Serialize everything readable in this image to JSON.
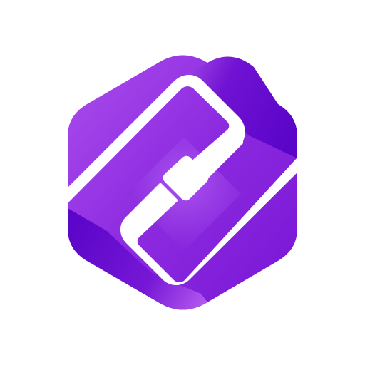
{
  "app_icon": {
    "name": "purple-hexagon-logo-icon",
    "colors": {
      "light_purple": "#C66CF7",
      "mid_purple": "#8D2BE0",
      "deep_purple": "#5A05C9",
      "background": "#FFFFFF",
      "cutout": "#FFFFFF"
    }
  }
}
